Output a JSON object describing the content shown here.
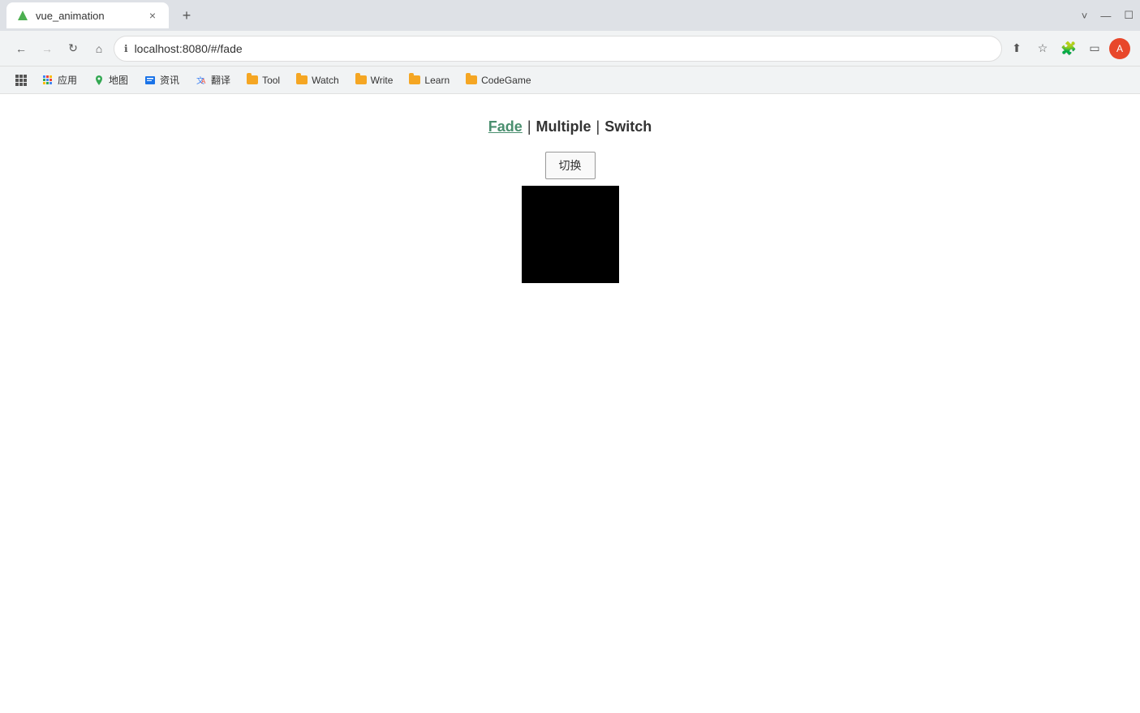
{
  "browser": {
    "tab": {
      "favicon": "V",
      "title": "vue_animation",
      "close_label": "×"
    },
    "new_tab_label": "+",
    "window_controls": {
      "chevron": "˅",
      "minimize": "—",
      "maximize": "☐"
    }
  },
  "navbar": {
    "back_label": "←",
    "forward_label": "→",
    "reload_label": "↻",
    "home_label": "⌂",
    "address": "localhost:8080/#/fade",
    "share_label": "⬆",
    "bookmark_label": "☆",
    "extensions_label": "🧩",
    "sidebar_label": "▭"
  },
  "bookmarks": {
    "apps_label": "⋮⋮⋮",
    "items": [
      {
        "id": "apps",
        "label": "应用",
        "has_folder": false,
        "is_apps": true
      },
      {
        "id": "maps",
        "label": "地图",
        "has_folder": false
      },
      {
        "id": "news",
        "label": "资讯",
        "has_folder": false
      },
      {
        "id": "translate",
        "label": "翻译",
        "has_folder": false
      },
      {
        "id": "tool",
        "label": "Tool",
        "has_folder": true
      },
      {
        "id": "watch",
        "label": "Watch",
        "has_folder": true
      },
      {
        "id": "write",
        "label": "Write",
        "has_folder": true
      },
      {
        "id": "learn",
        "label": "Learn",
        "has_folder": true
      },
      {
        "id": "codegame",
        "label": "CodeGame",
        "has_folder": true
      }
    ]
  },
  "page": {
    "nav_links": [
      {
        "id": "fade",
        "label": "Fade",
        "active": true
      },
      {
        "id": "multiple",
        "label": "Multiple",
        "active": false
      },
      {
        "id": "switch",
        "label": "Switch",
        "active": false
      }
    ],
    "separator": "|",
    "switch_button_label": "切换",
    "box_color": "#000000"
  }
}
